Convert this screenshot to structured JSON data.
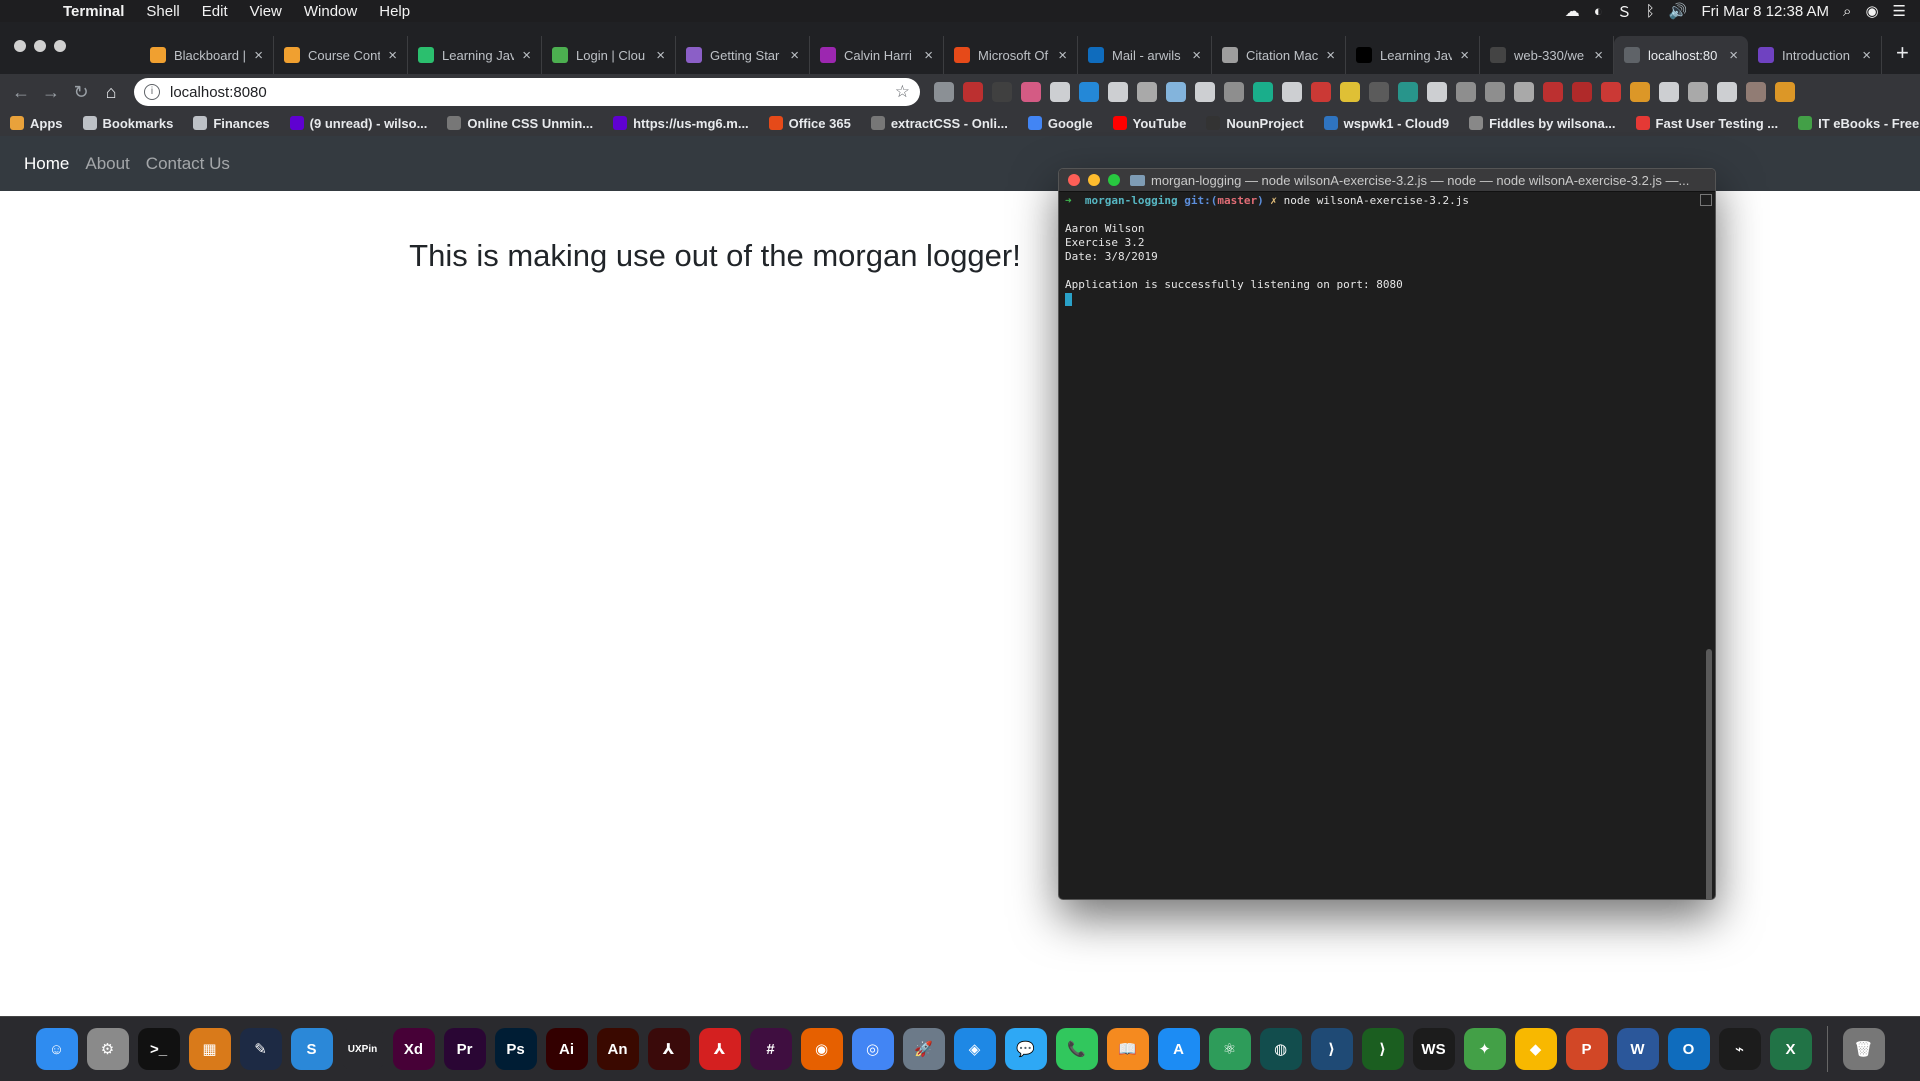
{
  "menubar": {
    "app_name": "Terminal",
    "items": [
      "Shell",
      "Edit",
      "View",
      "Window",
      "Help"
    ],
    "clock": "Fri Mar 8  12:38 AM"
  },
  "tabs": [
    {
      "title": "Blackboard |",
      "favicon_color": "#f0a030",
      "active": false
    },
    {
      "title": "Course Cont",
      "favicon_color": "#f0a030",
      "active": false
    },
    {
      "title": "Learning Jav",
      "favicon_color": "#2bbf6e",
      "active": false
    },
    {
      "title": "Login | Clou",
      "favicon_color": "#4caf50",
      "active": false
    },
    {
      "title": "Getting Star",
      "favicon_color": "#8b5fc7",
      "active": false
    },
    {
      "title": "Calvin Harri",
      "favicon_color": "#9c27b0",
      "active": false
    },
    {
      "title": "Microsoft Of",
      "favicon_color": "#e64a19",
      "active": false
    },
    {
      "title": "Mail - arwils",
      "favicon_color": "#0f6cbd",
      "active": false
    },
    {
      "title": "Citation Mac",
      "favicon_color": "#9e9e9e",
      "active": false
    },
    {
      "title": "Learning Jav",
      "favicon_color": "#000000",
      "active": false
    },
    {
      "title": "web-330/we",
      "favicon_color": "#444444",
      "active": false
    },
    {
      "title": "localhost:80",
      "favicon_color": "#5f6368",
      "active": true
    },
    {
      "title": "Introduction",
      "favicon_color": "#6f42c1",
      "active": false
    }
  ],
  "omnibox": {
    "url": "localhost:8080"
  },
  "bookmarks": [
    {
      "label": "Apps",
      "icon_color": "#e9a23b"
    },
    {
      "label": "Bookmarks",
      "icon_color": "#bdc1c6"
    },
    {
      "label": "Finances",
      "icon_color": "#bdc1c6"
    },
    {
      "label": "(9 unread) - wilso...",
      "icon_color": "#5f01d1"
    },
    {
      "label": "Online CSS Unmin...",
      "icon_color": "#777777"
    },
    {
      "label": "https://us-mg6.m...",
      "icon_color": "#5f01d1"
    },
    {
      "label": "Office 365",
      "icon_color": "#e64a19"
    },
    {
      "label": "extractCSS - Onli...",
      "icon_color": "#777777"
    },
    {
      "label": "Google",
      "icon_color": "#4285f4"
    },
    {
      "label": "YouTube",
      "icon_color": "#ff0000"
    },
    {
      "label": "NounProject",
      "icon_color": "#333333"
    },
    {
      "label": "wspwk1 - Cloud9",
      "icon_color": "#2f74c0"
    },
    {
      "label": "Fiddles by wilsona...",
      "icon_color": "#888888"
    },
    {
      "label": "Fast User Testing ...",
      "icon_color": "#e53935"
    },
    {
      "label": "IT eBooks - Free ...",
      "icon_color": "#43a047"
    }
  ],
  "site": {
    "nav": [
      {
        "label": "Home",
        "active": true
      },
      {
        "label": "About",
        "active": false
      },
      {
        "label": "Contact Us",
        "active": false
      }
    ],
    "heading": "This is making use out of the morgan logger!"
  },
  "terminal": {
    "title": "morgan-logging — node wilsonA-exercise-3.2.js — node — node wilsonA-exercise-3.2.js —...",
    "prompt": {
      "arrow": "➜",
      "dir": "morgan-logging",
      "git_label": "git:(",
      "branch": "master",
      "git_close": ")",
      "marker": "✗",
      "command": "node wilsonA-exercise-3.2.js"
    },
    "output": [
      "Aaron Wilson",
      "Exercise 3.2",
      "Date: 3/8/2019",
      "",
      "Application is successfully listening on port: 8080"
    ]
  },
  "dock": [
    {
      "name": "finder",
      "label": "☺",
      "color": "#2f8cf0"
    },
    {
      "name": "system-preferences",
      "label": "⚙",
      "color": "#8a8a8a"
    },
    {
      "name": "terminal",
      "label": ">_",
      "color": "#111111"
    },
    {
      "name": "keynote",
      "label": "▦",
      "color": "#d97a1a"
    },
    {
      "name": "typewriter",
      "label": "✎",
      "color": "#1d2a44"
    },
    {
      "name": "s-app",
      "label": "S",
      "color": "#2b88d8"
    },
    {
      "name": "uxpin",
      "label": "UXPin",
      "color": "#2a2a2e"
    },
    {
      "name": "adobe-xd",
      "label": "Xd",
      "color": "#470137"
    },
    {
      "name": "premiere",
      "label": "Pr",
      "color": "#2a0634"
    },
    {
      "name": "photoshop",
      "label": "Ps",
      "color": "#001d34"
    },
    {
      "name": "illustrator",
      "label": "Ai",
      "color": "#330000"
    },
    {
      "name": "animate",
      "label": "An",
      "color": "#3a0900"
    },
    {
      "name": "acrobat",
      "label": "⅄",
      "color": "#3a0a0a"
    },
    {
      "name": "acrobat-reader",
      "label": "⅄",
      "color": "#d42020"
    },
    {
      "name": "slack",
      "label": "#",
      "color": "#3f0e40"
    },
    {
      "name": "firefox",
      "label": "◉",
      "color": "#e66000"
    },
    {
      "name": "chrome",
      "label": "◎",
      "color": "#4285f4"
    },
    {
      "name": "launchpad",
      "label": "🚀",
      "color": "#6c7a89"
    },
    {
      "name": "safari",
      "label": "◈",
      "color": "#1e88e5"
    },
    {
      "name": "messages",
      "label": "💬",
      "color": "#2ea8f5"
    },
    {
      "name": "facetime",
      "label": "📞",
      "color": "#31c75d"
    },
    {
      "name": "books",
      "label": "📖",
      "color": "#f58a1f"
    },
    {
      "name": "app-store",
      "label": "A",
      "color": "#1c8cf4"
    },
    {
      "name": "atom",
      "label": "⚛",
      "color": "#2e9c5a"
    },
    {
      "name": "gitkraken",
      "label": "◍",
      "color": "#124d4d"
    },
    {
      "name": "vscode",
      "label": "⟩",
      "color": "#1f4a75"
    },
    {
      "name": "visual-studio-code-insiders",
      "label": "⟩",
      "color": "#1b5e20"
    },
    {
      "name": "webstorm",
      "label": "WS",
      "color": "#1c1c1c"
    },
    {
      "name": "sourcetree",
      "label": "✦",
      "color": "#43a047"
    },
    {
      "name": "sketch",
      "label": "◆",
      "color": "#f8b800"
    },
    {
      "name": "powerpoint",
      "label": "P",
      "color": "#d24726"
    },
    {
      "name": "word",
      "label": "W",
      "color": "#2b579a"
    },
    {
      "name": "outlook",
      "label": "O",
      "color": "#0f6cbd"
    },
    {
      "name": "activity-monitor",
      "label": "⌁",
      "color": "#1c1c1c"
    },
    {
      "name": "excel",
      "label": "X",
      "color": "#217346"
    },
    {
      "name": "trash",
      "label": "🗑",
      "color": "#777777"
    }
  ]
}
